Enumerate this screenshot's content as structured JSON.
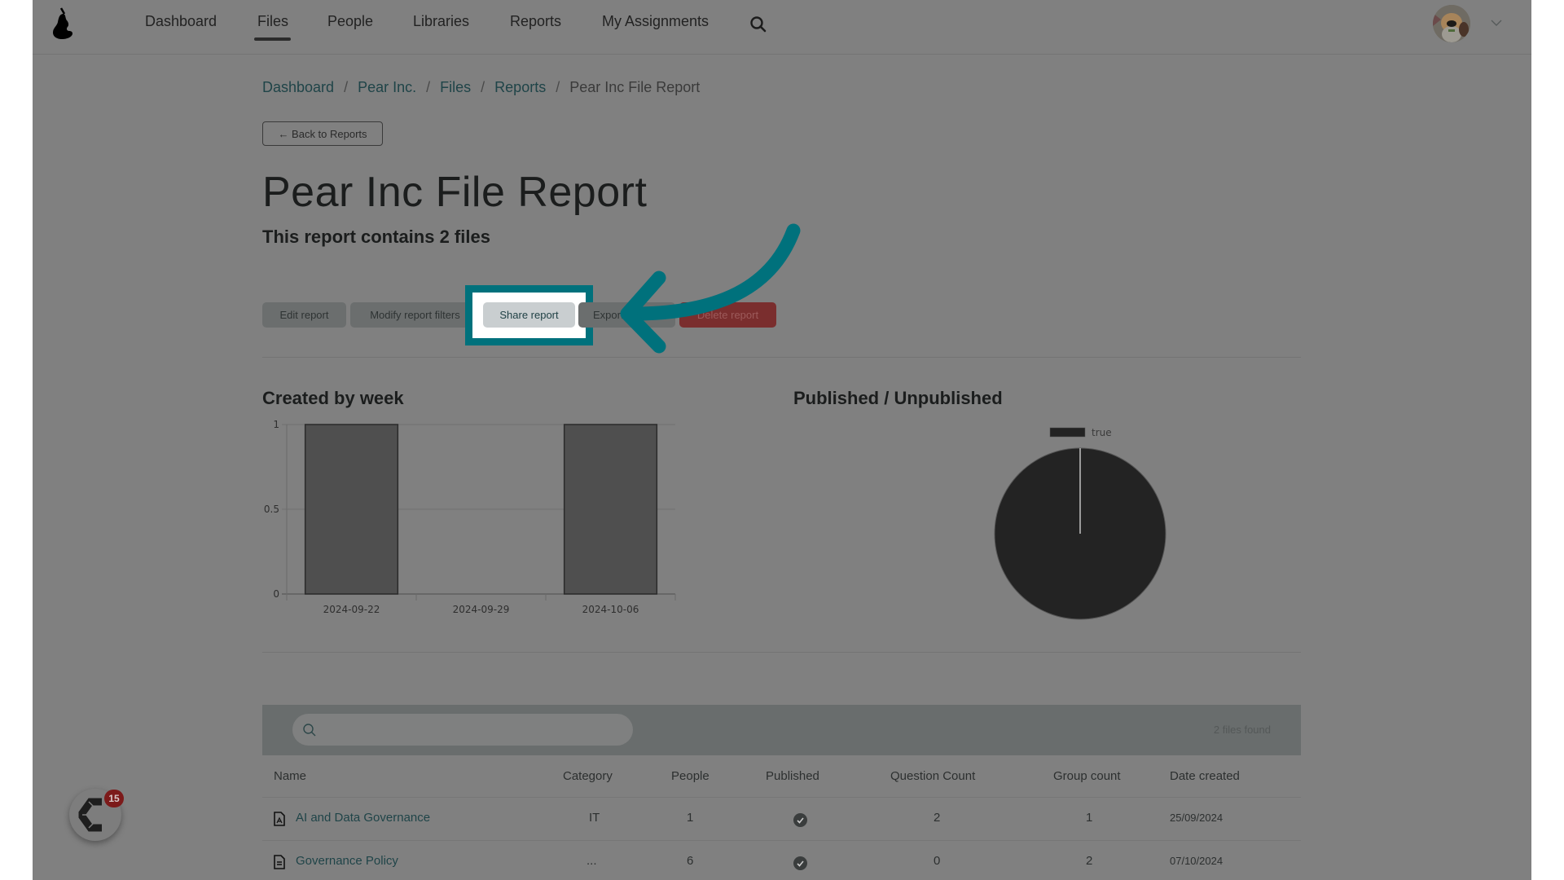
{
  "nav": {
    "items": [
      {
        "label": "Dashboard",
        "active": false
      },
      {
        "label": "Files",
        "active": true
      },
      {
        "label": "People",
        "active": false
      },
      {
        "label": "Libraries",
        "active": false
      },
      {
        "label": "Reports",
        "active": false
      },
      {
        "label": "My Assignments",
        "active": false
      }
    ],
    "search_icon": "search-icon",
    "avatar_icon": "user-avatar",
    "menu_icon": "chevron-down-icon"
  },
  "breadcrumb": {
    "items": [
      "Dashboard",
      "Pear Inc.",
      "Files",
      "Reports"
    ],
    "current": "Pear Inc File Report",
    "separator": "/"
  },
  "back_button": "← Back to Reports",
  "page": {
    "title": "Pear Inc File Report",
    "subtitle": "This report contains 2 files"
  },
  "actions": {
    "edit": "Edit report",
    "modify": "Modify report filters",
    "share": "Share report",
    "export": "Export",
    "delete": "Delete report"
  },
  "annotation": {
    "highlight_color": "#00717c",
    "target": "Share report"
  },
  "chart_data": [
    {
      "type": "bar",
      "title": "Created by week",
      "categories": [
        "2024-09-22",
        "2024-09-29",
        "2024-10-06"
      ],
      "values": [
        1,
        0,
        1
      ],
      "yticks": [
        "0",
        "0.5",
        "1"
      ],
      "ylim": [
        0,
        1
      ],
      "xlabel": "",
      "ylabel": "",
      "grid": true
    },
    {
      "type": "pie",
      "title": "Published / Unpublished",
      "labels": [
        "true"
      ],
      "values": [
        2
      ],
      "legend": "top"
    }
  ],
  "table": {
    "search_placeholder": "",
    "files_found": "2 files found",
    "columns": [
      "Name",
      "Category",
      "People",
      "Published",
      "Question Count",
      "Group count",
      "Date created"
    ],
    "rows": [
      {
        "icon": "pdf-file-icon",
        "name": "AI and Data Governance",
        "category": "IT",
        "people": "1",
        "published": true,
        "question_count": "2",
        "group_count": "1",
        "date_created": "25/09/2024"
      },
      {
        "icon": "document-file-icon",
        "name": "Governance Policy",
        "category": "...",
        "people": "6",
        "published": true,
        "question_count": "0",
        "group_count": "2",
        "date_created": "07/10/2024"
      }
    ]
  },
  "launcher": {
    "badge_count": "15"
  }
}
